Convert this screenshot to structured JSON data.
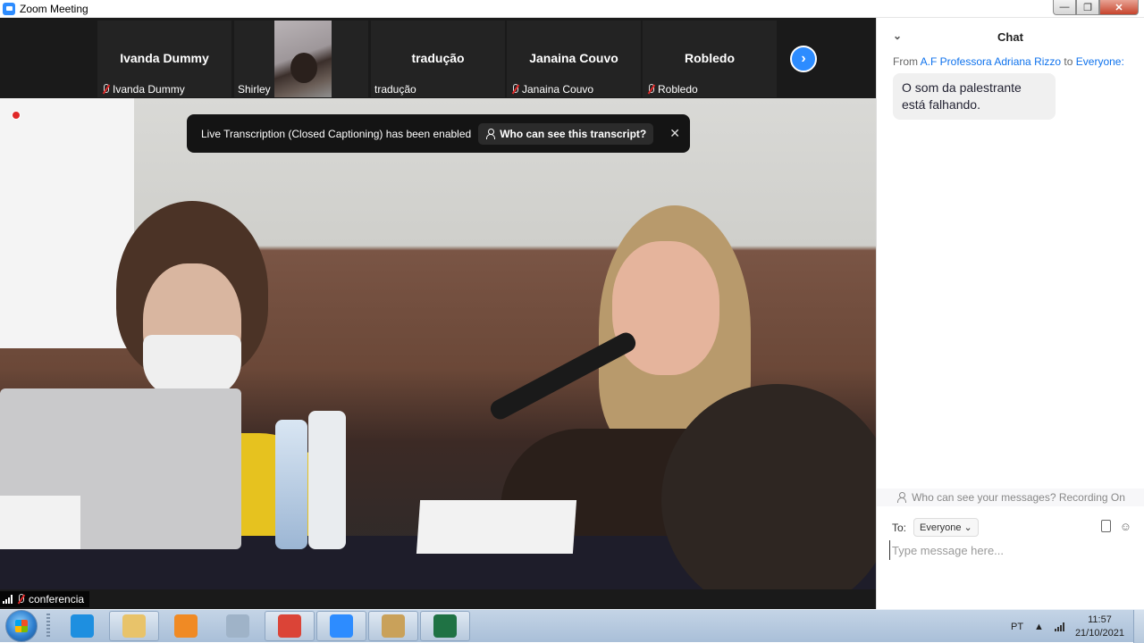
{
  "window": {
    "title": "Zoom Meeting",
    "minimize": "—",
    "maximize": "❐",
    "close": "✕"
  },
  "gallery": {
    "tiles": [
      {
        "big_name": "Ivanda Dummy",
        "label": "Ivanda Dummy",
        "muted": true
      },
      {
        "big_name": "",
        "label": "Shirley",
        "muted": false,
        "has_video": true
      },
      {
        "big_name": "tradução",
        "label": "tradução",
        "muted": false
      },
      {
        "big_name": "Janaina Couvo",
        "label": "Janaina Couvo",
        "muted": true
      },
      {
        "big_name": "Robledo",
        "label": "Robledo",
        "muted": true
      }
    ],
    "next_icon": "›"
  },
  "toast": {
    "message": "Live Transcription (Closed Captioning) has been enabled",
    "link": "Who can see this transcript?",
    "close": "✕"
  },
  "speaker": {
    "name": "conferencia",
    "muted": true
  },
  "chat": {
    "title": "Chat",
    "collapse_icon": "⌄",
    "from_prefix": "From",
    "sender": "A.F Professora Adriana Rizzo",
    "to_word": "to",
    "recipient": "Everyone:",
    "message": "O som da palestrante está falhando.",
    "notice": "Who can see your messages? Recording On",
    "to_label": "To:",
    "to_value": "Everyone ⌄",
    "emoji_icon": "☺",
    "input_placeholder": "Type message here..."
  },
  "taskbar": {
    "apps": [
      {
        "name": "internet-explorer",
        "color": "#1e8fe0",
        "active": false
      },
      {
        "name": "file-explorer",
        "color": "#e8c36a",
        "active": true
      },
      {
        "name": "media-player",
        "color": "#f08a24",
        "active": false
      },
      {
        "name": "calculator",
        "color": "#9fb3c8",
        "active": false
      },
      {
        "name": "chrome",
        "color": "#db4437",
        "active": true
      },
      {
        "name": "zoom",
        "color": "#2d8cff",
        "active": true
      },
      {
        "name": "paint",
        "color": "#c9a15a",
        "active": true
      },
      {
        "name": "excel",
        "color": "#1f7244",
        "active": true
      }
    ],
    "language": "PT",
    "tray_arrow": "▲",
    "time": "11:57",
    "date": "21/10/2021"
  }
}
